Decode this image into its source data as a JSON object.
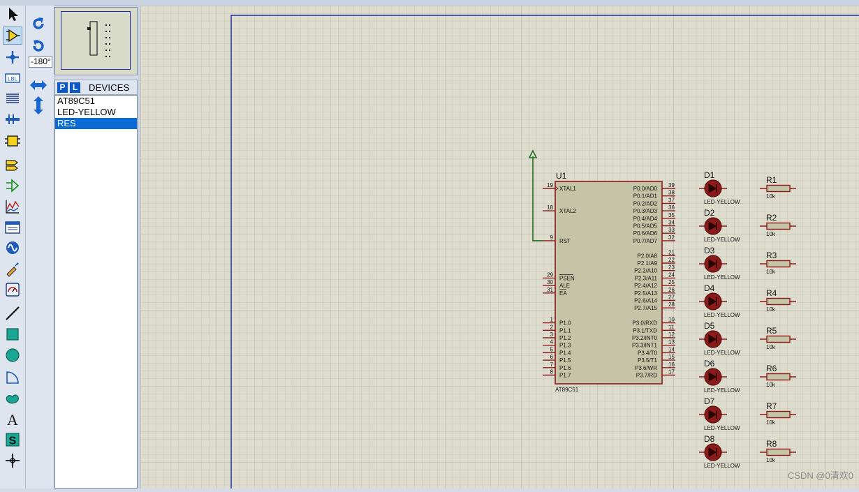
{
  "colors": {
    "canvas_bg": "#dedccd",
    "grid_minor": "#c6c5b6",
    "grid_major": "#b2b1a2",
    "sheet_border": "#1d2ba8",
    "component_fill": "#c6c4a6",
    "component_outline": "#8b1a1a",
    "wire": "#1e6b1e",
    "selection_blue": "#0b6bd6"
  },
  "toolbar": {
    "tools": [
      {
        "icon": "selection-arrow-icon"
      },
      {
        "icon": "component-mode-icon"
      },
      {
        "icon": "junction-dot-icon"
      },
      {
        "icon": "wire-label-icon"
      },
      {
        "icon": "text-script-icon"
      },
      {
        "icon": "bus-icon"
      },
      {
        "icon": "subcircuit-icon"
      },
      {
        "icon": "terminals-icon"
      },
      {
        "icon": "device-pins-icon"
      },
      {
        "icon": "graph-icon"
      },
      {
        "icon": "tape-recorder-icon"
      },
      {
        "icon": "generator-icon"
      },
      {
        "icon": "voltage-probe-icon"
      },
      {
        "icon": "virtual-instrument-icon"
      },
      {
        "icon": "line-icon"
      },
      {
        "icon": "box-icon"
      },
      {
        "icon": "circle-icon"
      },
      {
        "icon": "arc-icon"
      },
      {
        "icon": "closed-path-icon"
      },
      {
        "icon": "text-icon",
        "glyph": "A"
      },
      {
        "icon": "symbol-icon",
        "glyph": "S"
      },
      {
        "icon": "marker-icon"
      }
    ]
  },
  "rotation": {
    "angle_value": "-180°"
  },
  "devices": {
    "badge_p": "P",
    "badge_l": "L",
    "title": "DEVICES",
    "items": [
      "AT89C51",
      "LED-YELLOW",
      "RES"
    ],
    "selected_index": 2
  },
  "chip": {
    "ref": "U1",
    "part": "AT89C51",
    "left_pins": [
      {
        "num": "19",
        "name": "XTAL1",
        "slot": 0
      },
      {
        "num": "18",
        "name": "XTAL2",
        "slot": 3
      },
      {
        "num": "9",
        "name": "RST",
        "slot": 7
      },
      {
        "num": "29",
        "name": "PSEN",
        "slot": 12,
        "overbar": true
      },
      {
        "num": "30",
        "name": "ALE",
        "slot": 13
      },
      {
        "num": "31",
        "name": "EA",
        "slot": 14,
        "overbar": true
      },
      {
        "num": "1",
        "name": "P1.0",
        "slot": 18
      },
      {
        "num": "2",
        "name": "P1.1",
        "slot": 19
      },
      {
        "num": "3",
        "name": "P1.2",
        "slot": 20
      },
      {
        "num": "4",
        "name": "P1.3",
        "slot": 21
      },
      {
        "num": "5",
        "name": "P1.4",
        "slot": 22
      },
      {
        "num": "6",
        "name": "P1.5",
        "slot": 23
      },
      {
        "num": "7",
        "name": "P1.6",
        "slot": 24
      },
      {
        "num": "8",
        "name": "P1.7",
        "slot": 25
      }
    ],
    "right_pins": [
      {
        "num": "39",
        "name": "P0.0/AD0",
        "slot": 0
      },
      {
        "num": "38",
        "name": "P0.1/AD1",
        "slot": 1
      },
      {
        "num": "37",
        "name": "P0.2/AD2",
        "slot": 2
      },
      {
        "num": "36",
        "name": "P0.3/AD3",
        "slot": 3
      },
      {
        "num": "35",
        "name": "P0.4/AD4",
        "slot": 4
      },
      {
        "num": "34",
        "name": "P0.5/AD5",
        "slot": 5
      },
      {
        "num": "33",
        "name": "P0.6/AD6",
        "slot": 6
      },
      {
        "num": "32",
        "name": "P0.7/AD7",
        "slot": 7
      },
      {
        "num": "21",
        "name": "P2.0/A8",
        "slot": 9
      },
      {
        "num": "22",
        "name": "P2.1/A9",
        "slot": 10
      },
      {
        "num": "23",
        "name": "P2.2/A10",
        "slot": 11
      },
      {
        "num": "24",
        "name": "P2.3/A11",
        "slot": 12
      },
      {
        "num": "25",
        "name": "P2.4/A12",
        "slot": 13
      },
      {
        "num": "26",
        "name": "P2.5/A13",
        "slot": 14
      },
      {
        "num": "27",
        "name": "P2.6/A14",
        "slot": 15
      },
      {
        "num": "28",
        "name": "P2.7/A15",
        "slot": 16
      },
      {
        "num": "10",
        "name": "P3.0/RXD",
        "slot": 18
      },
      {
        "num": "11",
        "name": "P3.1/TXD",
        "slot": 19
      },
      {
        "num": "12",
        "name": "P3.2/INT0",
        "slot": 20
      },
      {
        "num": "13",
        "name": "P3.3/INT1",
        "slot": 21
      },
      {
        "num": "14",
        "name": "P3.4/T0",
        "slot": 22
      },
      {
        "num": "15",
        "name": "P3.5/T1",
        "slot": 23
      },
      {
        "num": "16",
        "name": "P3.6/WR",
        "slot": 24
      },
      {
        "num": "17",
        "name": "P3.7/RD",
        "slot": 25
      }
    ]
  },
  "leds": [
    {
      "ref": "D1",
      "value": "LED-YELLOW"
    },
    {
      "ref": "D2",
      "value": "LED-YELLOW"
    },
    {
      "ref": "D3",
      "value": "LED-YELLOW"
    },
    {
      "ref": "D4",
      "value": "LED-YELLOW"
    },
    {
      "ref": "D5",
      "value": "LED-YELLOW"
    },
    {
      "ref": "D6",
      "value": "LED-YELLOW"
    },
    {
      "ref": "D7",
      "value": "LED-YELLOW"
    },
    {
      "ref": "D8",
      "value": "LED-YELLOW"
    }
  ],
  "resistors": [
    {
      "ref": "R1",
      "value": "10k"
    },
    {
      "ref": "R2",
      "value": "10k"
    },
    {
      "ref": "R3",
      "value": "10k"
    },
    {
      "ref": "R4",
      "value": "10k"
    },
    {
      "ref": "R5",
      "value": "10k"
    },
    {
      "ref": "R6",
      "value": "10k"
    },
    {
      "ref": "R7",
      "value": "10k"
    },
    {
      "ref": "R8",
      "value": "10k"
    }
  ],
  "watermark": "CSDN @0清欢0"
}
